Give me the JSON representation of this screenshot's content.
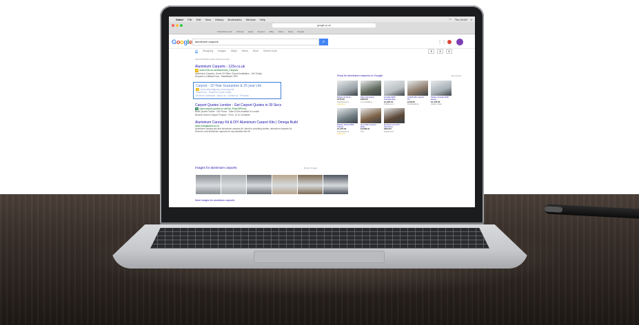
{
  "browser": {
    "app": "Safari",
    "menu": [
      "File",
      "Edit",
      "View",
      "History",
      "Bookmarks",
      "Window",
      "Help"
    ],
    "clock": "Thu 10:49",
    "url": "google.co.uk",
    "bookmarks": [
      "Oxfordshire Hub",
      "Chrissie",
      "Apple",
      "Amazon",
      "eBay",
      "Yahoo",
      "News",
      "Popular"
    ]
  },
  "google": {
    "logo": "Google",
    "query": "aluminium carports",
    "search_icon": "search-icon",
    "tabs": [
      "All",
      "Shopping",
      "Images",
      "Maps",
      "News",
      "More",
      "Search tools"
    ],
    "active_tab": "All",
    "stats": "About 844,000 results (0.35 seconds)",
    "logo_colors": [
      "#4285f4",
      "#db4437",
      "#f4b400",
      "#4285f4",
      "#0f9d58",
      "#db4437"
    ]
  },
  "results": [
    {
      "title": "Aluminium Carports - 123v.co.uk",
      "url": "www.123v.co.uk/Aluminium_Carports",
      "desc": "Aluminium Carports, Home Of Office. Expert Installation - Get Today!",
      "desc2": "Request a Callback Now · Established 1997",
      "ad": true,
      "highlighted": false
    },
    {
      "title": "Carport - 10 Year Guarantee & 25 year Life",
      "url": "www.nationalgroup.com/carports",
      "desc": "Experience · Request a quote today!",
      "desc2": "Brochure Download · About us · Contact us · Products",
      "ad": true,
      "highlighted": true
    },
    {
      "title": "Carport Quotes London - Get Carport Quotes in 30 Secs",
      "url": "www.carport-quotes.co.uk/Get_PriceOfPrices",
      "desc": "Build Quotes Online · Get Prices · Save £100s installed in London",
      "desc2": "Browse Recent Carport Projects · Fill in, 1s To Complete",
      "ad": true,
      "highlighted": false
    },
    {
      "title": "Aluminium Canopy Kit & DIY Aluminium Carport Kits | Omega Build",
      "url": "www.omegabuild.co.uk",
      "desc": "Aluminium canopy kits and aluminium carports kit. Ideal for providing shelter, aluminium carports for",
      "desc2": "Ekonom, and aluminium carports for any weather kits UK",
      "ad": false,
      "highlighted": false
    }
  ],
  "images": {
    "heading": "Images for aluminium carports",
    "report": "Report images",
    "more": "More images for aluminium carports",
    "tones": [
      "#8a8f94",
      "#a9adb0",
      "#6c7075",
      "#b7a68e",
      "#7d6a52",
      "#4f5560"
    ]
  },
  "shopping": {
    "heading": "Shop for aluminium carports on Google",
    "sponsored": "Sponsored",
    "products": [
      {
        "name": "Palram Feria 3x...",
        "price": "£575.00",
        "seller": "Greenhouse S...",
        "stars": "★★★★★",
        "tone": "#9aa3a9"
      },
      {
        "name": "Palm Aluminium",
        "price": "£560.00",
        "seller": "C & A Building...",
        "stars": "",
        "tone": "#5f6a5c"
      },
      {
        "name": "Arcadia 5000 Freestanding...",
        "price": "£1,322.10",
        "seller": "Fsbride.com",
        "stars": "",
        "tone": "#b9bfc2"
      },
      {
        "name": "3.00x5.20m carport PC...",
        "price": "£418.50",
        "seller": "FGuiltedHome",
        "stars": "",
        "tone": "#8c7b6a"
      },
      {
        "name": "Palram Arcadia 3000 Heavy...",
        "price": "£1,479.50",
        "seller": "Garden Oasis",
        "stars": "",
        "tone": "#a7b0b6"
      },
      {
        "name": "Palram Vitoria 5000 Carport",
        "price": "£1,275.00",
        "seller": "Greenhouse S...",
        "stars": "★★★★★",
        "tone": "#6f7c82"
      },
      {
        "name": "Log Cabin Carport Eiver...",
        "price": "£2,899.31",
        "seller": "Tuin",
        "stars": "",
        "tone": "#7a5f44"
      },
      {
        "name": "Evolution Car Port Aluminium",
        "price": "£850.00",
        "seller": "Fsbride.com",
        "stars": "",
        "tone": "#5a4636"
      }
    ]
  }
}
